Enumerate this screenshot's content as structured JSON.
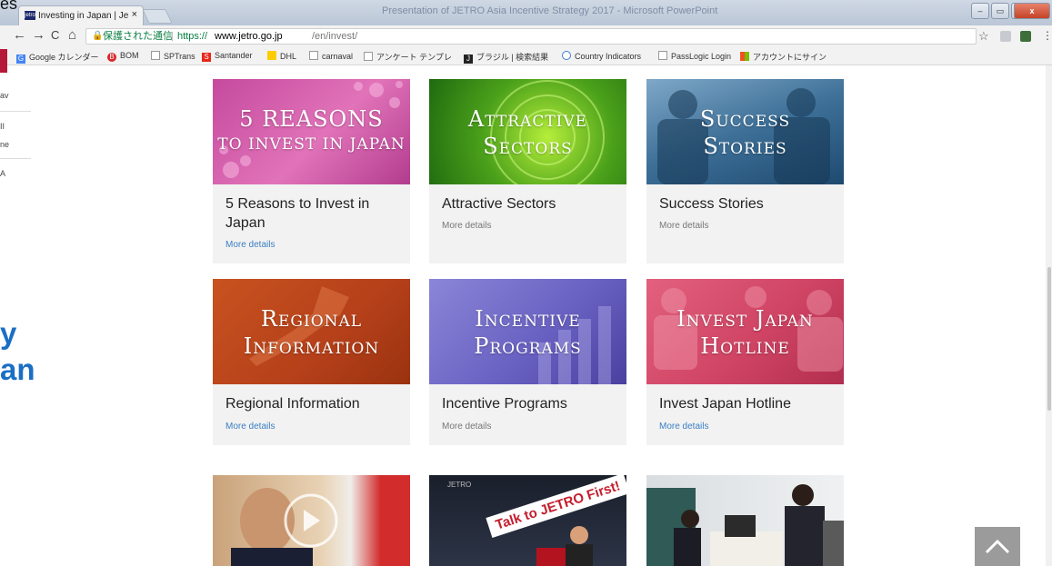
{
  "window": {
    "background_title": "Presentation of JETRO Asia Incentive Strategy 2017 - Microsoft PowerPoint",
    "stray_text": "es"
  },
  "tab": {
    "favicon_text": "jetro",
    "title": "Investing in Japan | Je",
    "close": "×"
  },
  "window_controls": {
    "minimize": "–",
    "restore": "▭",
    "extra": "▫",
    "close": "x"
  },
  "address_bar": {
    "back": "←",
    "forward": "→",
    "reload": "C",
    "home": "⌂",
    "lock": "🔒",
    "secure_label": "保護された通信",
    "separator": "|",
    "protocol": "https://",
    "host": "www.jetro.go.jp",
    "path": "/en/invest/",
    "star": "☆"
  },
  "bookmarks": [
    {
      "label": "Google カレンダー",
      "icon": "G",
      "color": "#4285f4"
    },
    {
      "label": "BOM",
      "icon": "B",
      "color": "#d9262a"
    },
    {
      "label": "SPTrans",
      "icon": "",
      "color": "#bbbbbb"
    },
    {
      "label": "Santander",
      "icon": "S",
      "color": "#e8261a"
    },
    {
      "label": "DHL",
      "icon": "",
      "color": "#ffcc00"
    },
    {
      "label": "carnaval",
      "icon": "",
      "color": "#bbbbbb"
    },
    {
      "label": "アンケート テンプレ",
      "icon": "",
      "color": "#bbbbbb"
    },
    {
      "label": "ブラジル | 検索結果",
      "icon": "J",
      "color": "#222222"
    },
    {
      "label": "Country Indicators",
      "icon": "",
      "color": "#3e7bd6"
    },
    {
      "label": "PassLogic Login",
      "icon": "",
      "color": "#bbbbbb"
    },
    {
      "label": "アカウントにサイン",
      "icon": "",
      "color": "#f25022"
    }
  ],
  "left_panel": {
    "snip1": "av",
    "snip2": "II",
    "snip3": "ne",
    "snip4": "A",
    "big1": "y",
    "big2": "an"
  },
  "cards": [
    {
      "banner_line1": "5 REASONS",
      "banner_line2": "TO INVEST IN JAPAN",
      "title": "5 Reasons to Invest in Japan",
      "more": "More details"
    },
    {
      "banner_line1": "Attractive",
      "banner_line2": "Sectors",
      "title": "Attractive Sectors",
      "more": "More details"
    },
    {
      "banner_line1": "Success",
      "banner_line2": "Stories",
      "title": "Success Stories",
      "more": "More details"
    },
    {
      "banner_line1": "Regional",
      "banner_line2": "Information",
      "title": "Regional Information",
      "more": "More details"
    },
    {
      "banner_line1": "Incentive",
      "banner_line2": "Programs",
      "title": "Incentive Programs",
      "more": "More details"
    },
    {
      "banner_line1": "Invest Japan",
      "banner_line2": "Hotline",
      "title": "Invest Japan Hotline",
      "more": "More details"
    }
  ],
  "bottom_images": {
    "sign_text": "Talk to JETRO First!",
    "jetro_label": "JETRO"
  },
  "colors": {
    "link": "#3a7fc4",
    "card_bg": "#f2f2f2",
    "accent_blue": "#1a6fc4"
  },
  "scroll_top_icon": "chevron-up-icon"
}
